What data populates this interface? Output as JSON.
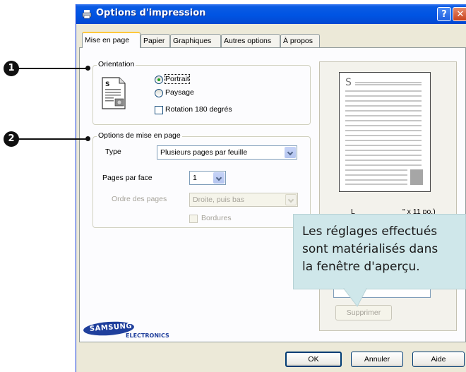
{
  "window": {
    "title": "Options d'impression",
    "help_label": "?",
    "close_label": "✕"
  },
  "tabs": [
    "Mise en page",
    "Papier",
    "Graphiques",
    "Autres options",
    "À propos"
  ],
  "orientation": {
    "legend": "Orientation",
    "portrait": "Portrait",
    "landscape": "Paysage",
    "rotate": "Rotation 180 degrés",
    "selected": "Portrait"
  },
  "layout_options": {
    "legend": "Options de mise en page",
    "type_label": "Type",
    "type_value": "Plusieurs pages par feuille",
    "pages_per_side_label": "Pages par face",
    "pages_per_side_value": "1",
    "page_order_label": "Ordre des pages",
    "page_order_value": "Droite, puis bas",
    "borders_label": "Bordures"
  },
  "preview": {
    "page_letter": "S",
    "size_caption_left": "L",
    "size_caption_right": "\" x 11 po.)"
  },
  "delete_button": "Supprimer",
  "brand": {
    "name": "SAMSUNG",
    "sub": "ELECTRONICS"
  },
  "footer": {
    "ok": "OK",
    "cancel": "Annuler",
    "help": "Aide"
  },
  "callout": {
    "lines": [
      "Les réglages effectués",
      "sont matérialisés dans",
      "la fenêtre d'aperçu."
    ]
  },
  "markers": [
    "1",
    "2"
  ],
  "icons": [
    "printer-icon",
    "portrait-orientation-icon"
  ]
}
